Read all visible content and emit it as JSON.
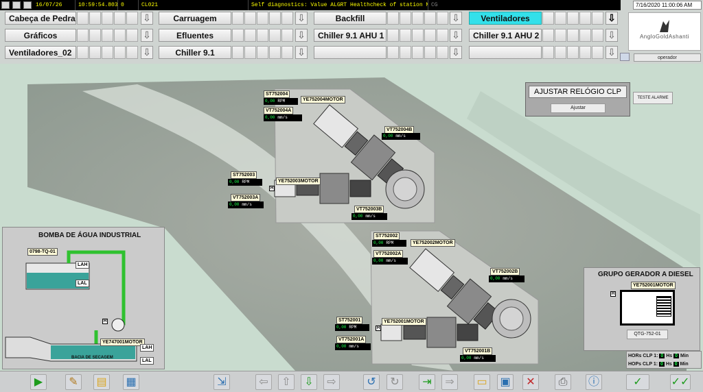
{
  "status_bar": {
    "date": "16/07/26",
    "time": "10:59:54.803",
    "count": "0",
    "code": "CL021",
    "message": "Self diagnostics: Value ALGRT Healthcheck of station Machine",
    "suffix": "CG"
  },
  "datetime": "7/16/2020 11:00:06 AM",
  "nav": {
    "row1": [
      "Cabeça de Pedra",
      "Carruagem",
      "Backfill",
      "Ventiladores"
    ],
    "row2": [
      "Gráficos",
      "Efluentes",
      "Chiller 9.1 AHU 1",
      "Chiller 9.1 AHU 2"
    ],
    "row3": [
      "Ventiladores_02",
      "Chiller 9.1",
      "",
      ""
    ],
    "active": "Ventiladores"
  },
  "logo_text": "AngloGoldAshanti",
  "user": "operador",
  "clock_panel": {
    "title": "AJUSTAR RELÓGIO CLP",
    "button": "Ajustar"
  },
  "alarm_test_button": "TESTE ALARME",
  "fans": [
    {
      "id": "F1",
      "status_tag": "ST752004",
      "speed": "0,00",
      "speed_unit": "RPM",
      "motor_tag": "YE752004MOTOR",
      "vib_tag_a": "VT752004A",
      "vib_a": "0,00",
      "vib_a_unit": "mm/s",
      "vib_tag_b": "VT752004B",
      "vib_b": "0,00",
      "vib_b_unit": "mm/s"
    },
    {
      "id": "F2",
      "status_tag": "ST752003",
      "speed": "0,00",
      "speed_unit": "RPM",
      "motor_tag": "YE752003MOTOR",
      "vib_tag_a": "VT752003A",
      "vib_a": "0,00",
      "vib_a_unit": "mm/s",
      "vib_tag_b": "VT752003B",
      "vib_b": "0,00",
      "vib_b_unit": "mm/s"
    },
    {
      "id": "F3",
      "status_tag": "ST752002",
      "speed": "0,00",
      "speed_unit": "RPM",
      "motor_tag": "YE752002MOTOR",
      "vib_tag_a": "VT752002A",
      "vib_a": "0,00",
      "vib_a_unit": "mm/s",
      "vib_tag_b": "VT752002B",
      "vib_b": "0,00",
      "vib_b_unit": "mm/s"
    },
    {
      "id": "F4",
      "status_tag": "ST752001",
      "speed": "0,00",
      "speed_unit": "RPM",
      "motor_tag": "YE752001MOTOR",
      "vib_tag_a": "VT752001A",
      "vib_a": "0,00",
      "vib_a_unit": "mm/s",
      "vib_tag_b": "VT752001B",
      "vib_b": "0,00",
      "vib_b_unit": "mm/s"
    }
  ],
  "pump_panel": {
    "title": "BOMBA DE ÁGUA INDUSTRIAL",
    "tank_tag": "0798-TQ-01",
    "lah": "LAH",
    "lal": "LAL",
    "motor_tag": "YE747001MOTOR",
    "basin": "BACIA DE SECAGEM",
    "h": "H"
  },
  "generator_panel": {
    "title": "GRUPO GERADOR A DIESEL",
    "motor_tag": "YE752001MOTOR",
    "unit_tag": "QTG-752-01",
    "hors_label": "HORs CLP 1:",
    "hors_hrs": "0",
    "hrs_unit": "Hs",
    "hors_min": "0",
    "min_unit": "Min",
    "hops_label": "HOPs CLP 1:",
    "hops_hrs": "0",
    "hops_min": "0"
  },
  "toolbar_icons": [
    "play-icon",
    "wrench-icon",
    "page-icon",
    "document-icon",
    "export-icon",
    "arrow-left-icon",
    "arrow-up-icon",
    "arrow-down-icon",
    "arrow-right-icon",
    "undo-icon",
    "redo-icon",
    "login-icon",
    "forward-icon",
    "folder-icon",
    "save-icon",
    "delete-icon",
    "print-icon",
    "info-icon",
    "checkmarks-icon"
  ],
  "colors": {
    "active_tab": "#33e0ea",
    "display_text": "#1aff4a",
    "pipe": "#2fc12f",
    "water": "#3aa39a"
  }
}
